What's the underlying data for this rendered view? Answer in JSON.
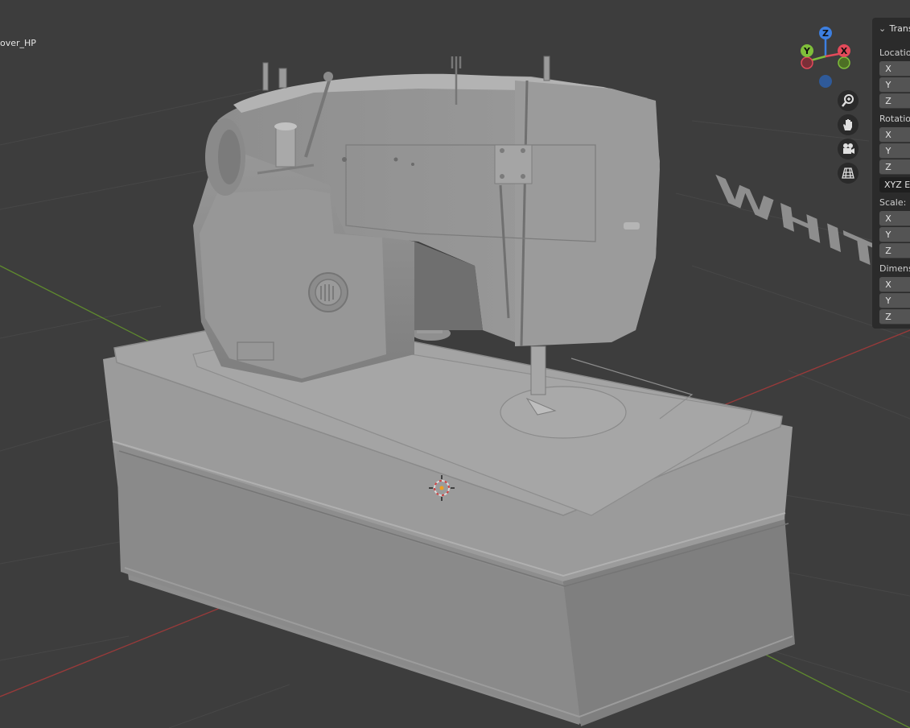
{
  "viewport": {
    "object_name": "over_HP",
    "background_text": "WHIT"
  },
  "gizmo": {
    "z": "Z",
    "y": "Y",
    "x": "X",
    "colors": {
      "x": "#e34a5a",
      "y": "#7fbf3a",
      "z": "#3d7fe0",
      "neg_z": "#2f5a99"
    }
  },
  "nav_buttons": [
    {
      "icon": "zoom-icon"
    },
    {
      "icon": "pan-hand-icon"
    },
    {
      "icon": "camera-icon"
    },
    {
      "icon": "ortho-grid-icon"
    }
  ],
  "npanel": {
    "title": "Trans",
    "location_label": "Locatio",
    "rotation_label": "Rotation",
    "scale_label": "Scale:",
    "dimensions_label": "Dimens",
    "mode": "XYZ E",
    "axes": [
      "X",
      "Y",
      "Z"
    ]
  }
}
